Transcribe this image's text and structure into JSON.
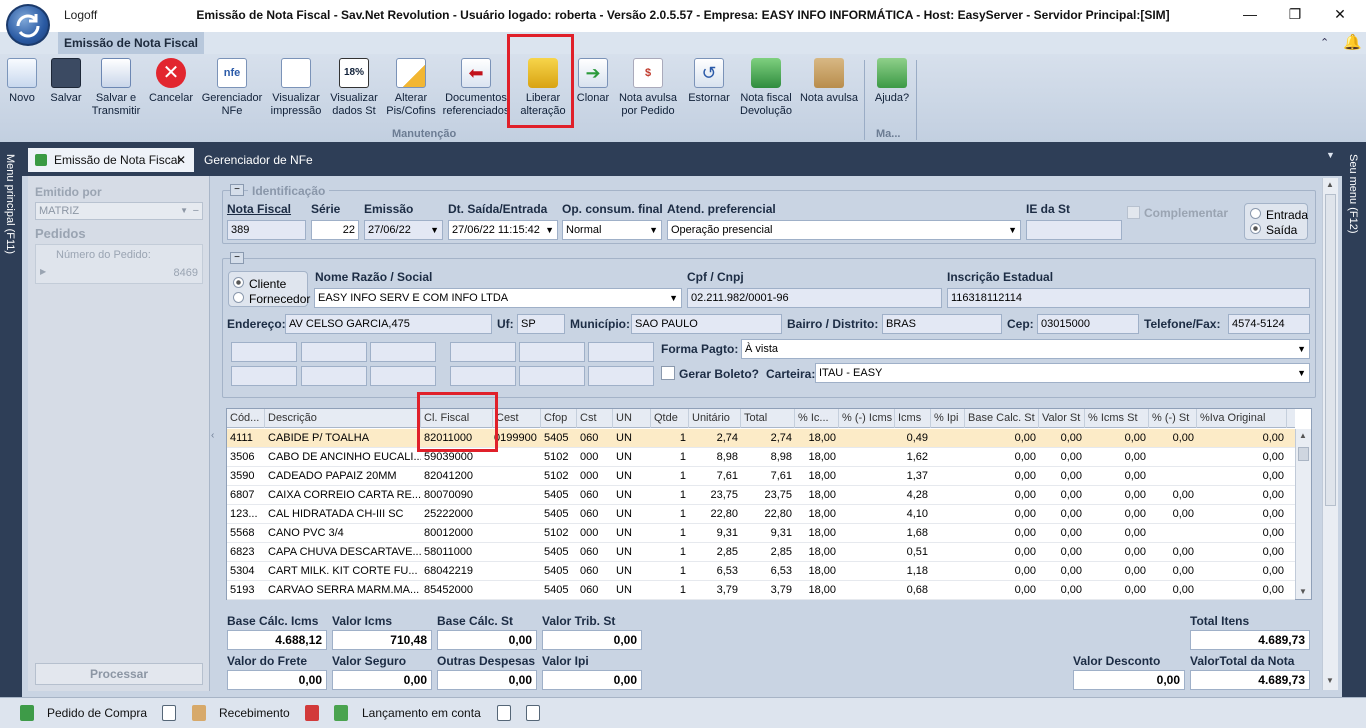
{
  "window": {
    "logoff": "Logoff",
    "title": "Emissão de Nota Fiscal - Sav.Net Revolution - Usuário logado: roberta - Versão 2.0.5.57 - Empresa: EASY INFO INFORMÁTICA - Host: EasyServer - Servidor Principal:[SIM]",
    "minimize": "—",
    "restore": "❐",
    "close": "✕"
  },
  "ribbon": {
    "tab": "Emissão de Nota Fiscal",
    "buttons": [
      {
        "l1": "Novo",
        "l2": ""
      },
      {
        "l1": "Salvar",
        "l2": ""
      },
      {
        "l1": "Salvar e",
        "l2": "Transmitir"
      },
      {
        "l1": "Cancelar",
        "l2": ""
      },
      {
        "l1": "Gerenciador",
        "l2": "NFe"
      },
      {
        "l1": "Visualizar",
        "l2": "impressão"
      },
      {
        "l1": "Visualizar",
        "l2": "dados St"
      },
      {
        "l1": "Alterar",
        "l2": "Pis/Cofins"
      },
      {
        "l1": "Documentos",
        "l2": "referenciados"
      },
      {
        "l1": "Liberar",
        "l2": "alteração"
      },
      {
        "l1": "Clonar",
        "l2": ""
      },
      {
        "l1": "Nota avulsa",
        "l2": "por Pedido"
      },
      {
        "l1": "Estornar",
        "l2": ""
      },
      {
        "l1": "Nota fiscal",
        "l2": "Devolução"
      },
      {
        "l1": "Nota avulsa",
        "l2": ""
      },
      {
        "l1": "Ajuda?",
        "l2": ""
      }
    ],
    "group1": "Manutenção",
    "group2": "Ma..."
  },
  "side": {
    "left": "Menu principal (F11)",
    "right": "Seu menu (F12)"
  },
  "doctabs": {
    "tab1": "Emissão de Nota Fiscal",
    "tab1_close": "✕",
    "tab2": "Gerenciador de NFe"
  },
  "leftpanel": {
    "emitido_por": "Emitido por",
    "emitido_val": "MATRIZ",
    "pedidos": "Pedidos",
    "numero_pedido": "Número do Pedido:",
    "pedido_val": "8469",
    "processar": "Processar"
  },
  "ident": {
    "title": "Identificação",
    "nf_lbl": "Nota Fiscal",
    "nf_val": "389",
    "serie_lbl": "Série",
    "serie_val": "22",
    "emissao_lbl": "Emissão",
    "emissao_val": "27/06/22",
    "dtsaida_lbl": "Dt. Saída/Entrada",
    "dtsaida_val": "27/06/22 11:15:42",
    "opcons_lbl": "Op. consum. final",
    "opcons_val": "Normal",
    "atend_lbl": "Atend. preferencial",
    "atend_val": "Operação presencial",
    "iest_lbl": "IE da St",
    "iest_val": "",
    "complementar": "Complementar",
    "entrada": "Entrada",
    "saida": "Saída"
  },
  "dest": {
    "cliente": "Cliente",
    "fornecedor": "Fornecedor",
    "nome_lbl": "Nome Razão / Social",
    "nome_val": "EASY INFO SERV E COM INFO LTDA",
    "cpf_lbl": "Cpf / Cnpj",
    "cpf_val": "02.211.982/0001-96",
    "ie_lbl": "Inscrição Estadual",
    "ie_val": "116318112114",
    "end_lbl": "Endereço:",
    "end_val": "AV CELSO GARCIA,475",
    "uf_lbl": "Uf:",
    "uf_val": "SP",
    "mun_lbl": "Município:",
    "mun_val": "SAO PAULO",
    "bairro_lbl": "Bairro / Distrito:",
    "bairro_val": "BRAS",
    "cep_lbl": "Cep:",
    "cep_val": "03015000",
    "tel_lbl": "Telefone/Fax:",
    "tel_val": "4574-5124",
    "formapagto_lbl": "Forma Pagto:",
    "formapagto_val": "À vista",
    "gerar_boleto": "Gerar Boleto?",
    "carteira_lbl": "Carteira:",
    "carteira_val": "ITAU - EASY"
  },
  "grid": {
    "columns": [
      "Cód...",
      "Descrição",
      "Cl. Fiscal",
      "Cest",
      "Cfop",
      "Cst",
      "UN",
      "Qtde",
      "Unitário",
      "Total",
      "% Ic...",
      "% (-) Icms",
      "Icms",
      "% Ipi",
      "Base Calc. St",
      "Valor St",
      "% Icms St",
      "% (-) St",
      "%Iva Original"
    ],
    "rows": [
      [
        "4111",
        "CABIDE P/ TOALHA",
        "82011000",
        "0199900",
        "5405",
        "060",
        "UN",
        "1",
        "2,74",
        "2,74",
        "18,00",
        "",
        "0,49",
        "",
        "0,00",
        "0,00",
        "0,00",
        "0,00",
        "0,00"
      ],
      [
        "3506",
        "CABO DE ANCINHO EUCALI...",
        "59039000",
        "",
        "5102",
        "000",
        "UN",
        "1",
        "8,98",
        "8,98",
        "18,00",
        "",
        "1,62",
        "",
        "0,00",
        "0,00",
        "0,00",
        "",
        "0,00"
      ],
      [
        "3590",
        "CADEADO PAPAIZ 20MM",
        "82041200",
        "",
        "5102",
        "000",
        "UN",
        "1",
        "7,61",
        "7,61",
        "18,00",
        "",
        "1,37",
        "",
        "0,00",
        "0,00",
        "0,00",
        "",
        "0,00"
      ],
      [
        "6807",
        "CAIXA CORREIO CARTA RE...",
        "80070090",
        "",
        "5405",
        "060",
        "UN",
        "1",
        "23,75",
        "23,75",
        "18,00",
        "",
        "4,28",
        "",
        "0,00",
        "0,00",
        "0,00",
        "0,00",
        "0,00"
      ],
      [
        "123...",
        "CAL HIDRATADA CH-III SC",
        "25222000",
        "",
        "5405",
        "060",
        "UN",
        "1",
        "22,80",
        "22,80",
        "18,00",
        "",
        "4,10",
        "",
        "0,00",
        "0,00",
        "0,00",
        "0,00",
        "0,00"
      ],
      [
        "5568",
        "CANO PVC 3/4",
        "80012000",
        "",
        "5102",
        "000",
        "UN",
        "1",
        "9,31",
        "9,31",
        "18,00",
        "",
        "1,68",
        "",
        "0,00",
        "0,00",
        "0,00",
        "",
        "0,00"
      ],
      [
        "6823",
        "CAPA CHUVA DESCARTAVE...",
        "58011000",
        "",
        "5405",
        "060",
        "UN",
        "1",
        "2,85",
        "2,85",
        "18,00",
        "",
        "0,51",
        "",
        "0,00",
        "0,00",
        "0,00",
        "0,00",
        "0,00"
      ],
      [
        "5304",
        "CART MILK. KIT CORTE FU...",
        "68042219",
        "",
        "5405",
        "060",
        "UN",
        "1",
        "6,53",
        "6,53",
        "18,00",
        "",
        "1,18",
        "",
        "0,00",
        "0,00",
        "0,00",
        "0,00",
        "0,00"
      ],
      [
        "5193",
        "CARVAO SERRA MARM.MA...",
        "85452000",
        "",
        "5405",
        "060",
        "UN",
        "1",
        "3,79",
        "3,79",
        "18,00",
        "",
        "0,68",
        "",
        "0,00",
        "0,00",
        "0,00",
        "0,00",
        "0,00"
      ]
    ]
  },
  "totals": {
    "base_icms_lbl": "Base Cálc. Icms",
    "base_icms": "4.688,12",
    "valor_icms_lbl": "Valor Icms",
    "valor_icms": "710,48",
    "base_st_lbl": "Base Cálc. St",
    "base_st": "0,00",
    "valor_trib_lbl": "Valor Trib. St",
    "valor_trib": "0,00",
    "total_itens_lbl": "Total Itens",
    "total_itens": "4.689,73",
    "frete_lbl": "Valor do Frete",
    "frete": "0,00",
    "seguro_lbl": "Valor Seguro",
    "seguro": "0,00",
    "outras_lbl": "Outras Despesas",
    "outras": "0,00",
    "ipi_lbl": "Valor Ipi",
    "ipi": "0,00",
    "desconto_lbl": "Valor Desconto",
    "desconto": "0,00",
    "total_nota_lbl": "ValorTotal da Nota",
    "total_nota": "4.689,73"
  },
  "bottom": {
    "pedido": "Pedido de Compra",
    "recebimento": "Recebimento",
    "lancamento": "Lançamento em conta"
  }
}
